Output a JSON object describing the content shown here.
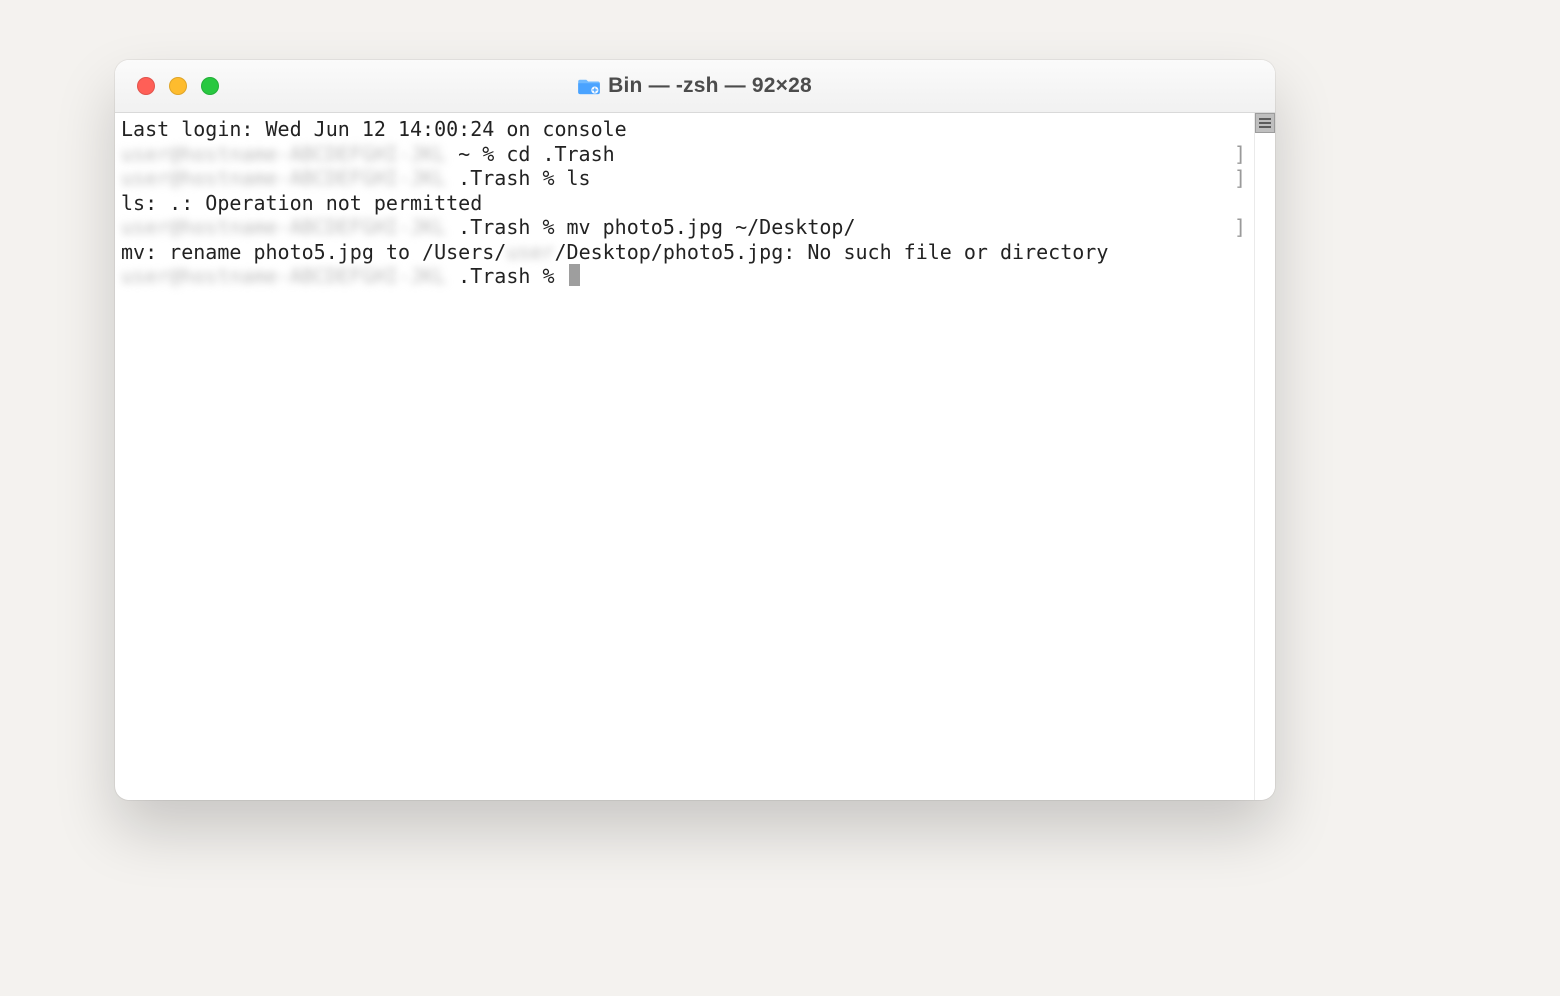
{
  "titlebar": {
    "title": "Bin — -zsh — 92×28"
  },
  "terminal": {
    "redacted_host": "user@hostname-ABCDEFGHI-JKL",
    "redacted_user": "user",
    "lines": {
      "login": "Last login: Wed Jun 12 14:00:24 on console",
      "p1_suffix": " ~ % cd .Trash",
      "p2_suffix": " .Trash % ls",
      "err1": "ls: .: Operation not permitted",
      "p3_suffix": " .Trash % mv photo5.jpg ~/Desktop/",
      "err2a": "mv: rename photo5.jpg to /Users/",
      "err2b": "/Desktop/photo5.jpg: No such file or directory",
      "p4_suffix": " .Trash % "
    },
    "right_bracket": "]"
  }
}
